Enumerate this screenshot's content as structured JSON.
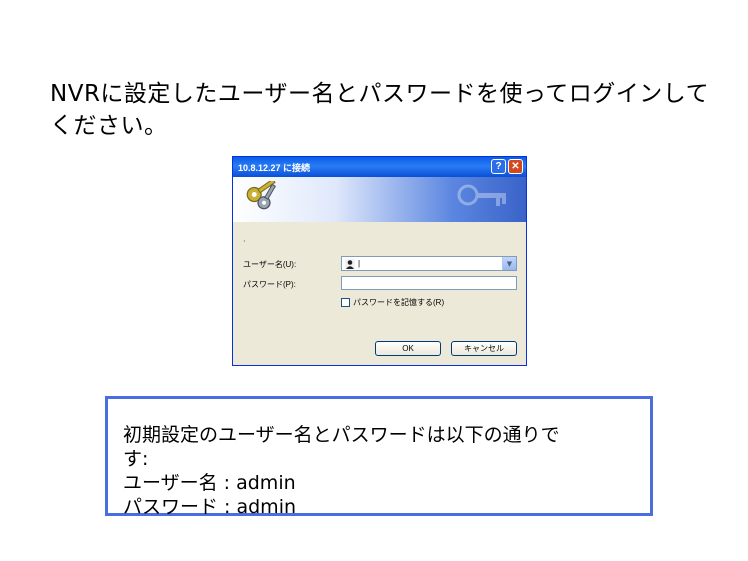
{
  "instruction": "NVRに設定したユーザー名とパスワードを使ってログインしてください。",
  "dialog": {
    "title": "10.8.12.27 に接続",
    "help_button": "?",
    "close_button": "✕",
    "dot": "·",
    "username_label": "ユーザー名(U):",
    "username_value": "|",
    "password_label": "パスワード(P):",
    "password_value": "",
    "remember_label": "パスワードを記憶する(R)",
    "remember_checked": false,
    "ok_label": "OK",
    "cancel_label": "キャンセル",
    "icons": {
      "banner": "keys-icon",
      "user": "user-avatar-icon",
      "dropdown": "chevron-down-icon"
    }
  },
  "info": {
    "line1": "初期設定のユーザー名とパスワードは以下の通りで",
    "line2": "す:",
    "line3": "ユーザー名 : admin",
    "line4": "パスワード : admin"
  },
  "colors": {
    "info_border": "#4a6ee0",
    "titlebar": "#0a5ce8",
    "dialog_bg": "#ece9d8"
  }
}
